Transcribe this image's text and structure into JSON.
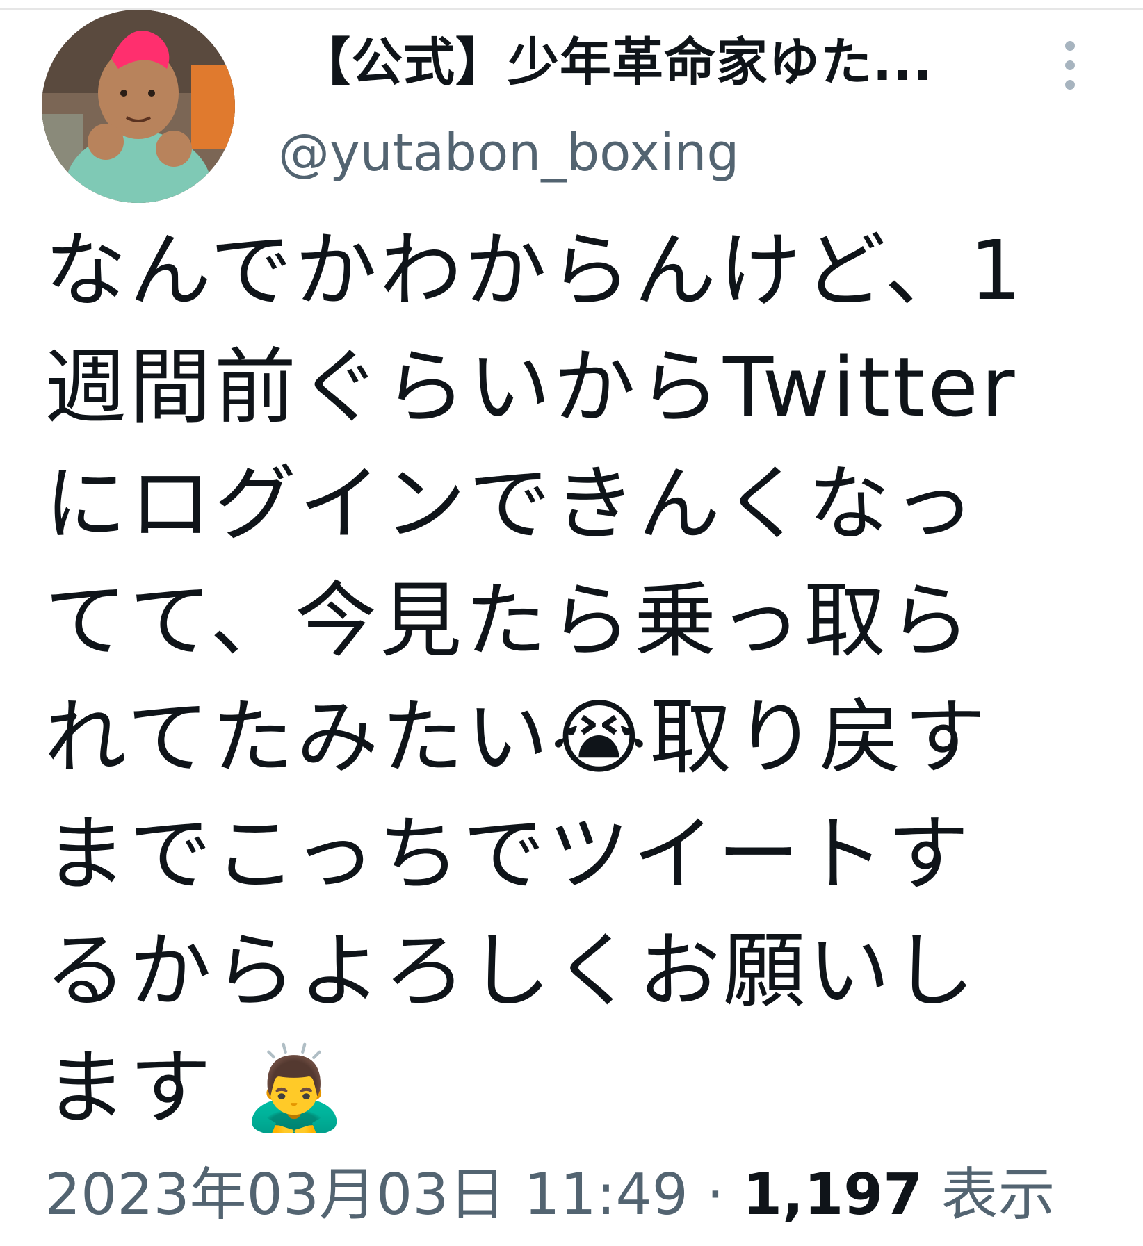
{
  "tweet": {
    "display_name": "【公式】少年革命家ゆた...",
    "handle": "@yutabon_boxing",
    "more_icon": "more-vertical-icon",
    "text": "なんでかわからんけど、1\n週間前ぐらいからTwitter\nにログインできんくなっ\nてて、今見たら乗っ取ら\nれてたみたい😭取り戻す\nまでこっちでツイートす\nるからよろしくお願いし\nます 🙇‍♂️",
    "timestamp": "2023年03月03日 11:49",
    "separator": "·",
    "views_count": "1,197",
    "views_label": "表示"
  },
  "colors": {
    "text_primary": "#0f1419",
    "text_secondary": "#536471",
    "avatar_hair": "#ff2f6e"
  }
}
